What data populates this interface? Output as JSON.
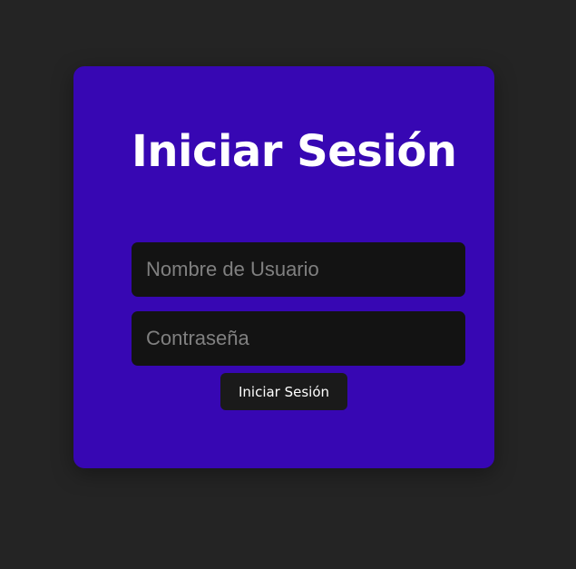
{
  "login": {
    "title": "Iniciar Sesión",
    "username_placeholder": "Nombre de Usuario",
    "username_value": "",
    "password_placeholder": "Contraseña",
    "password_value": "",
    "submit_label": "Iniciar Sesión"
  },
  "colors": {
    "background": "#242424",
    "card": "#3707b3",
    "input": "#131313",
    "button": "#1a1a1a",
    "text": "#ffffff",
    "placeholder": "#808080"
  }
}
